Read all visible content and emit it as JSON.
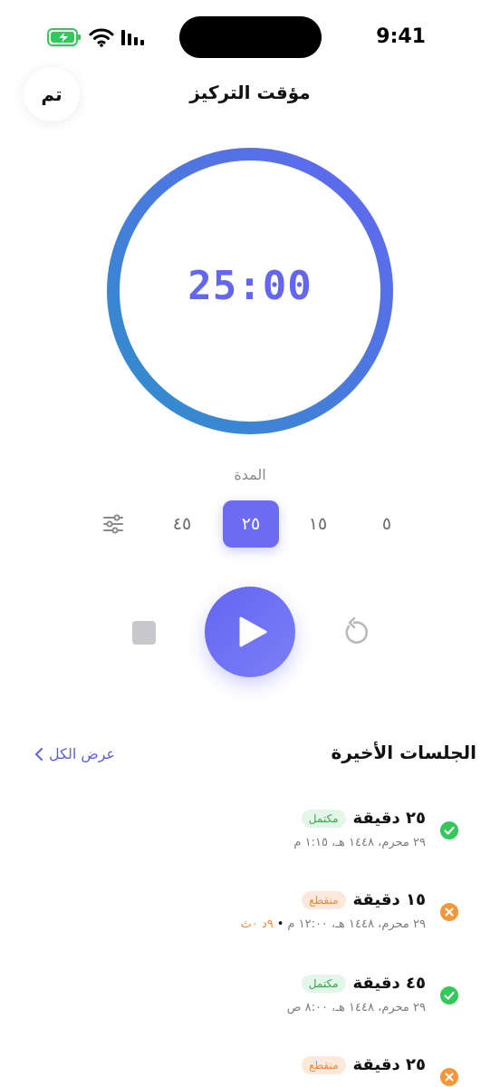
{
  "status_bar": {
    "time": "9:41"
  },
  "header": {
    "title": "مؤقت التركيز",
    "done_label": "تم"
  },
  "timer": {
    "display": "25:00"
  },
  "duration": {
    "label": "المدة",
    "options": [
      "٥",
      "١٥",
      "٢٥",
      "٤٥"
    ],
    "selected": "٢٥"
  },
  "recent": {
    "title": "الجلسات الأخيرة",
    "view_all": "عرض الكل",
    "sessions": [
      {
        "duration": "٢٥ دقيقة",
        "status": "مكتمل",
        "date": "٢٩ محرم، ١٤٤٨ هـ، ١:١٥ م",
        "extra": ""
      },
      {
        "duration": "١٥ دقيقة",
        "status": "منقطع",
        "date": "٢٩ محرم، ١٤٤٨ هـ، ١٢:٠٠ م",
        "extra": "٩د ٠ث"
      },
      {
        "duration": "٤٥ دقيقة",
        "status": "مكتمل",
        "date": "٢٩ محرم، ١٤٤٨ هـ، ٨:٠٠ ص",
        "extra": ""
      },
      {
        "duration": "٢٥ دقيقة",
        "status": "منقطع",
        "date": "",
        "extra": ""
      }
    ]
  },
  "colors": {
    "accent": "#6366f1",
    "ring_start": "#2f8fca",
    "ring_end": "#6366f1",
    "ok": "#34c759",
    "warn": "#f59638"
  }
}
